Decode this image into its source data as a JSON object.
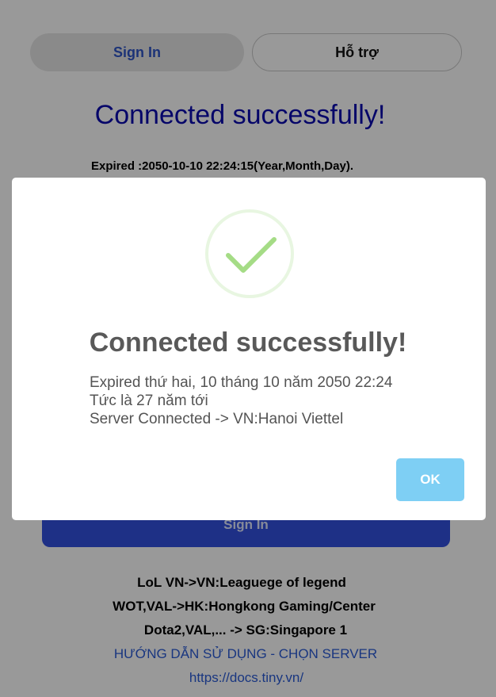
{
  "tabs": {
    "signin_label": "Sign In",
    "support_label": "Hỗ trợ"
  },
  "background": {
    "title": "Connected successfully!",
    "expired": "Expired :2050-10-10 22:24:15(Year,Month,Day).",
    "signin_button": "Sign In",
    "info_lines": [
      "LoL VN->VN:Leaguege of legend",
      "WOT,VAL->HK:Hongkong Gaming/Center",
      "Dota2,VAL,... -> SG:Singapore 1"
    ],
    "guide_link": "HƯỚNG DẪN SỬ DỤNG - CHỌN SERVER",
    "docs_link": "https://docs.tiny.vn/"
  },
  "modal": {
    "icon": "success-check-icon",
    "title": "Connected successfully!",
    "lines": [
      "Expired thứ hai, 10 tháng 10 năm 2050 22:24",
      "Tức là 27 năm tới",
      "Server Connected -> VN:Hanoi Viettel"
    ],
    "ok_label": "OK"
  },
  "colors": {
    "accent_blue": "#3250e0",
    "title_blue": "#0a0ab0",
    "ok_button": "#7ecff4",
    "success_green": "#a5dc86",
    "overlay": "rgba(0,0,0,0.4)"
  }
}
